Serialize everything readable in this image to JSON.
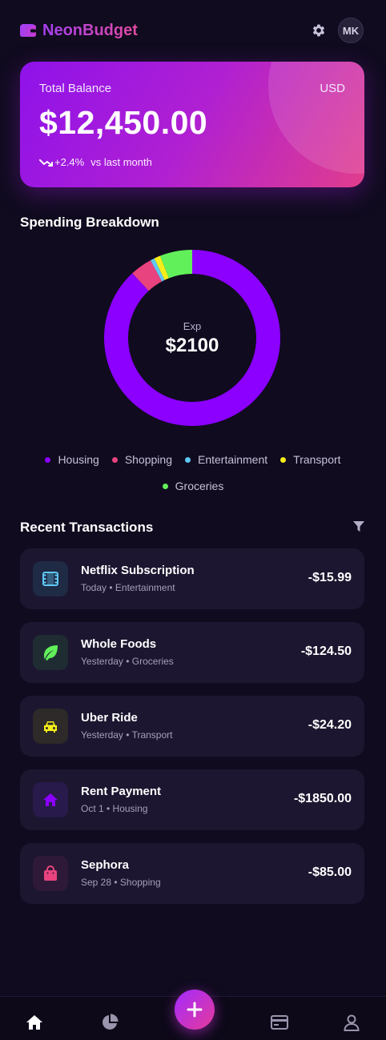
{
  "header": {
    "app_name": "NeonBudget",
    "brand_icon": "wallet-icon",
    "settings_icon": "gear-icon",
    "avatar_initials": "MK"
  },
  "balance": {
    "label": "Total Balance",
    "currency": "USD",
    "amount": "$12,450.00",
    "change": "+2.4%",
    "change_suffix": "vs last month",
    "trend_icon": "trend-up-icon"
  },
  "spending": {
    "title": "Spending Breakdown",
    "center_label": "Exp",
    "center_value": "$2100"
  },
  "chart_data": {
    "type": "pie",
    "title": "Spending Breakdown",
    "categories": [
      "Housing",
      "Shopping",
      "Entertainment",
      "Transport",
      "Groceries"
    ],
    "values": [
      1850,
      85,
      15.99,
      24.2,
      124.5
    ],
    "colors": [
      "#8b00ff",
      "#e8437e",
      "#5ec8f5",
      "#f5ee1a",
      "#62f05a"
    ],
    "legend_position": "bottom"
  },
  "transactions": {
    "title": "Recent Transactions",
    "filter_icon": "filter-icon",
    "items": [
      {
        "name": "Netflix Subscription",
        "meta": "Today • Entertainment",
        "amount": "-$15.99",
        "icon": "film-icon",
        "color": "#5ec8f5",
        "bg": "#1f2a44"
      },
      {
        "name": "Whole Foods",
        "meta": "Yesterday • Groceries",
        "amount": "-$124.50",
        "icon": "leaf-icon",
        "color": "#62f05a",
        "bg": "#1f2d33"
      },
      {
        "name": "Uber Ride",
        "meta": "Yesterday • Transport",
        "amount": "-$24.20",
        "icon": "car-icon",
        "color": "#f5ee1a",
        "bg": "#2d2a29"
      },
      {
        "name": "Rent Payment",
        "meta": "Oct 1 • Housing",
        "amount": "-$1850.00",
        "icon": "home-icon",
        "color": "#8b00ff",
        "bg": "#281a4a"
      },
      {
        "name": "Sephora",
        "meta": "Sep 28 • Shopping",
        "amount": "-$85.00",
        "icon": "shopping-bag-icon",
        "color": "#e8437e",
        "bg": "#2e1a38"
      }
    ]
  },
  "nav": {
    "home_icon": "home-icon",
    "chart_icon": "pie-chart-icon",
    "add_icon": "plus-icon",
    "card_icon": "credit-card-icon",
    "profile_icon": "user-icon"
  }
}
